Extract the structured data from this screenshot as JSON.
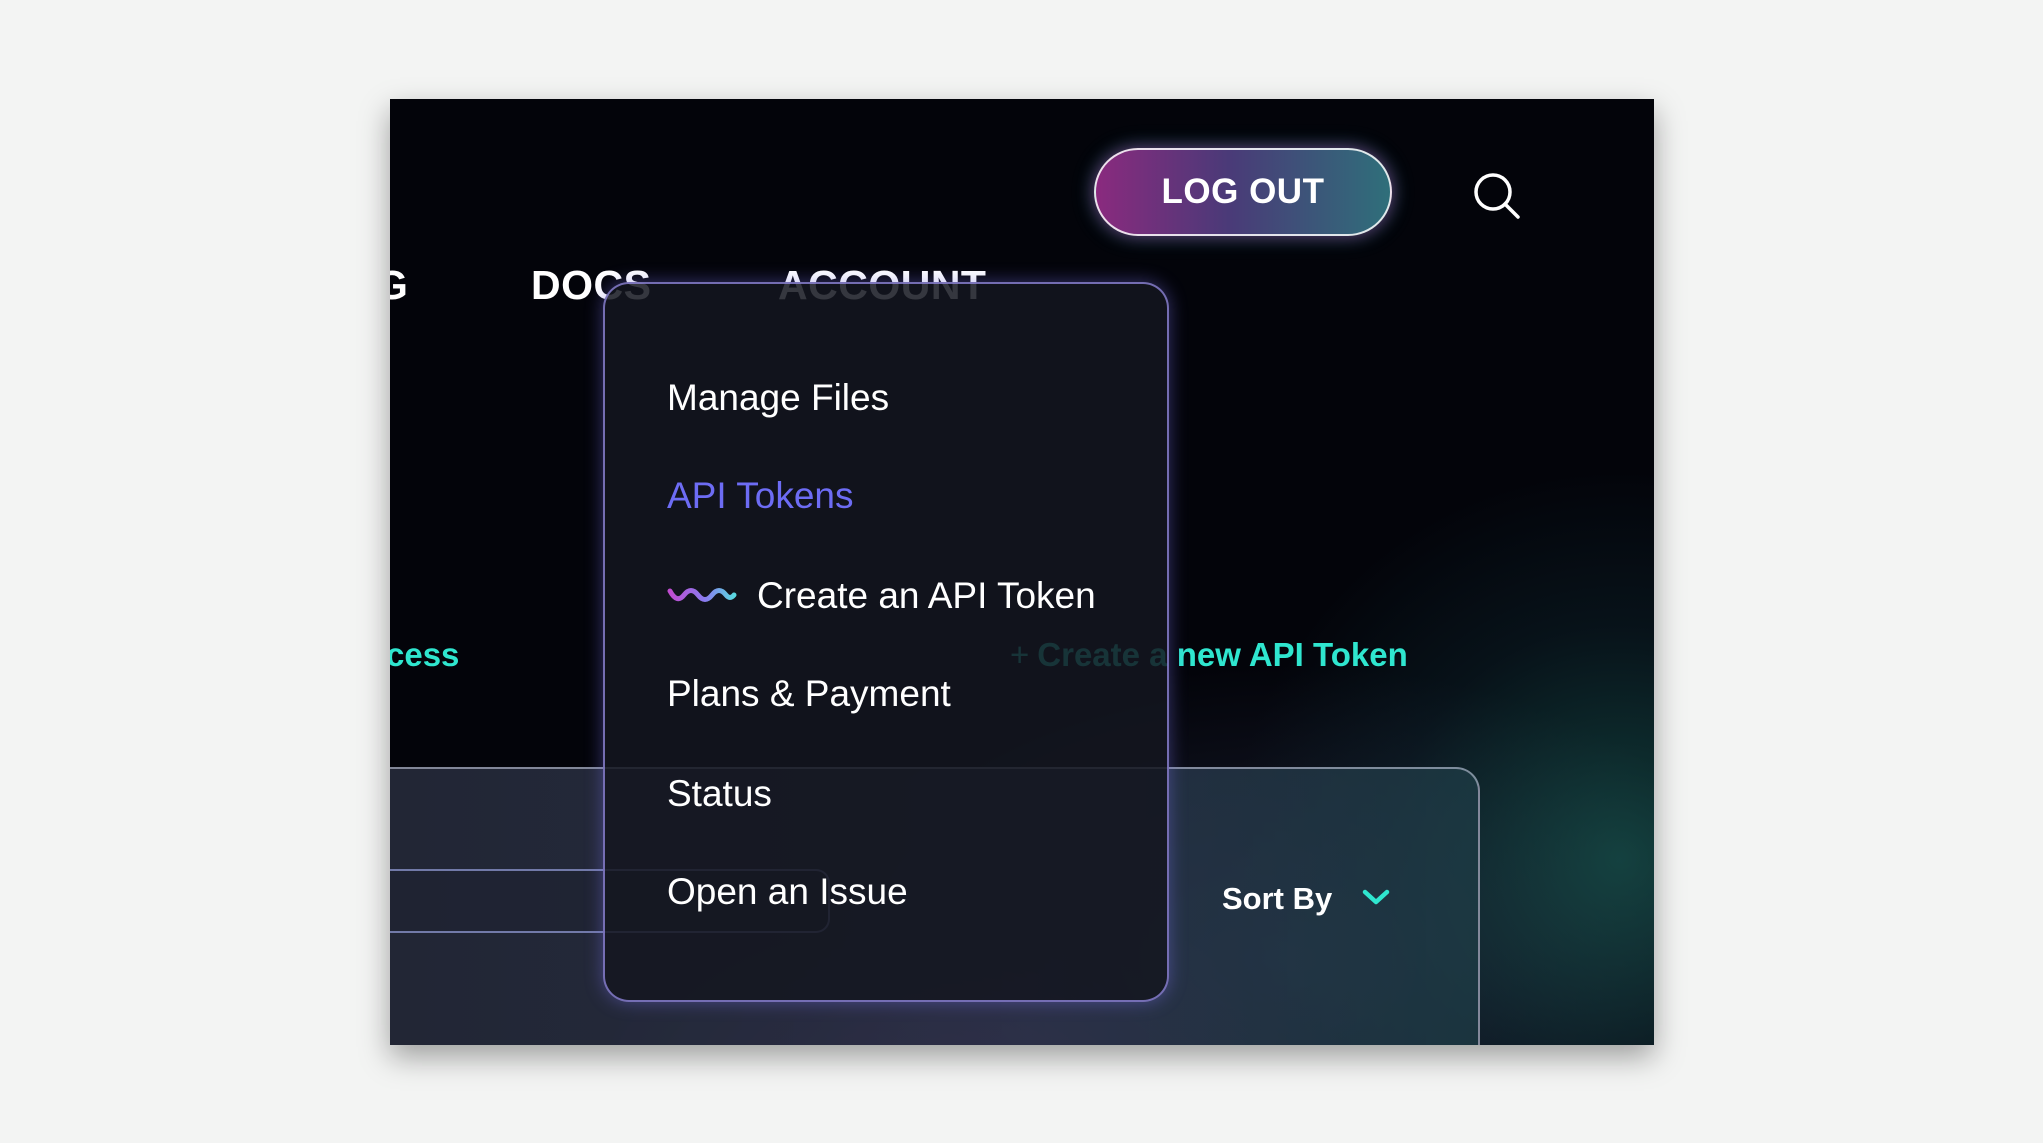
{
  "nav": {
    "cut_item_label": "G",
    "docs_label": "DOCS",
    "account_label": "ACCOUNT",
    "logout_label": "LOG OUT",
    "search_icon": "search-icon"
  },
  "background": {
    "left_link_text": "cess",
    "create_link_plus": "+",
    "create_link_text": "Create a new API Token",
    "sort_by_label": "Sort By",
    "sort_icon": "chevron-down-icon"
  },
  "dropdown": {
    "items": [
      {
        "label": "Manage Files",
        "active": false
      },
      {
        "label": "API Tokens",
        "active": true
      },
      {
        "label": "Create an API Token",
        "icon": "wave-icon",
        "active": false
      },
      {
        "label": "Plans & Payment",
        "active": false
      },
      {
        "label": "Status",
        "active": false
      },
      {
        "label": "Open an Issue",
        "active": false
      }
    ]
  },
  "colors": {
    "accent_teal": "#2fe6cf",
    "accent_purple": "#6d6cf4",
    "background": "#03040a"
  }
}
